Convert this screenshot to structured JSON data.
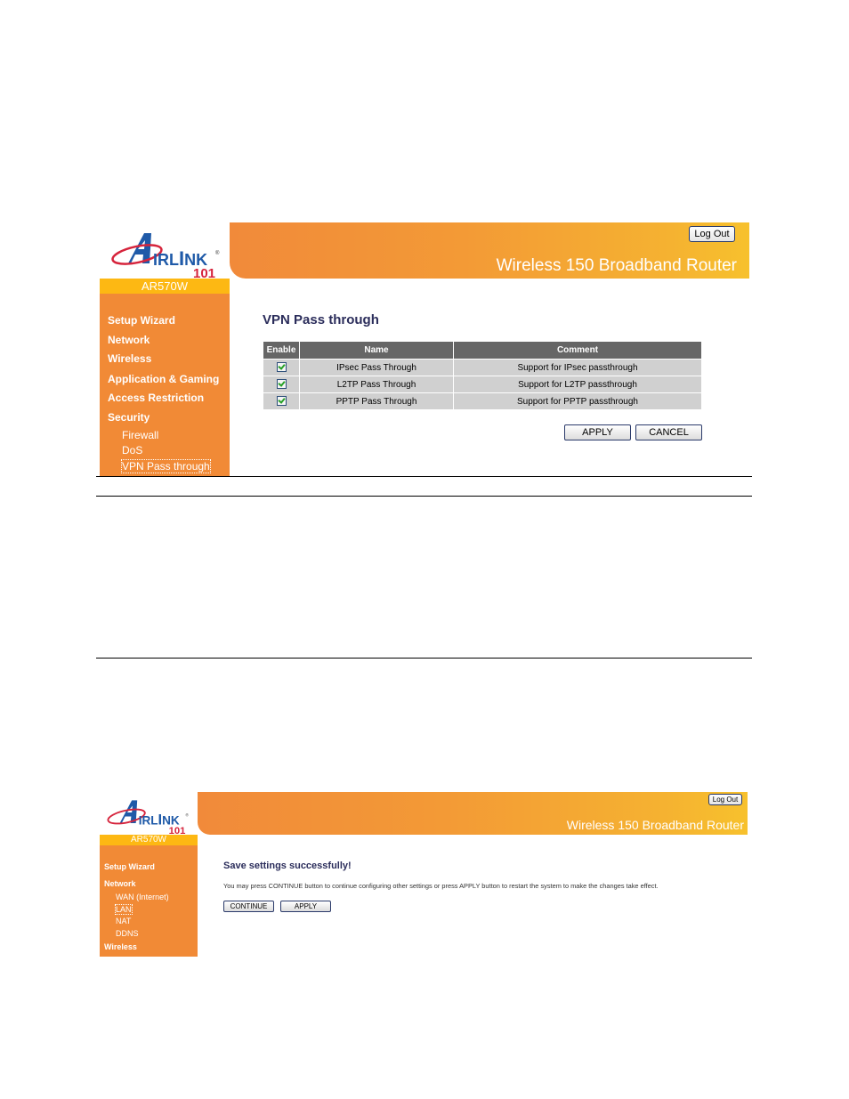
{
  "screenshot1": {
    "brand": {
      "logo_text": "AIRLINK",
      "logo_sub": "101",
      "model": "AR570W"
    },
    "header": {
      "title": "Wireless 150 Broadband Router",
      "logout_label": "Log Out"
    },
    "sidebar": {
      "items": [
        {
          "label": "Setup Wizard"
        },
        {
          "label": "Network"
        },
        {
          "label": "Wireless"
        },
        {
          "label": "Application & Gaming"
        },
        {
          "label": "Access Restriction"
        },
        {
          "label": "Security"
        }
      ],
      "subitems": [
        {
          "label": "Firewall",
          "active": false
        },
        {
          "label": "DoS",
          "active": false
        },
        {
          "label": "VPN Pass through",
          "active": true
        }
      ]
    },
    "main": {
      "title": "VPN Pass through",
      "table": {
        "headers": [
          "Enable",
          "Name",
          "Comment"
        ],
        "rows": [
          {
            "enabled": true,
            "name": "IPsec Pass Through",
            "comment": "Support for IPsec passthrough"
          },
          {
            "enabled": true,
            "name": "L2TP Pass Through",
            "comment": "Support for L2TP passthrough"
          },
          {
            "enabled": true,
            "name": "PPTP Pass Through",
            "comment": "Support for PPTP passthrough"
          }
        ]
      },
      "apply_label": "APPLY",
      "cancel_label": "CANCEL"
    }
  },
  "screenshot2": {
    "brand": {
      "logo_text": "AIRLINK",
      "logo_sub": "101",
      "model": "AR570W"
    },
    "header": {
      "title": "Wireless 150 Broadband Router",
      "logout_label": "Log Out"
    },
    "sidebar": {
      "items": [
        {
          "label": "Setup Wizard"
        },
        {
          "label": "Network"
        },
        {
          "label": "Wireless"
        }
      ],
      "subitems": [
        {
          "label": "WAN (Internet)",
          "active": false
        },
        {
          "label": "LAN",
          "active": true
        },
        {
          "label": "NAT",
          "active": false
        },
        {
          "label": "DDNS",
          "active": false
        }
      ]
    },
    "main": {
      "title": "Save settings successfully!",
      "message": "You may press CONTINUE button to continue configuring other settings or press APPLY button to restart the system to make the changes take effect.",
      "continue_label": "CONTINUE",
      "apply_label": "APPLY"
    }
  },
  "colors": {
    "sidebar": "#f18a36",
    "model_strip": "#fdb813",
    "table_header": "#666666",
    "table_row": "#d0d0d0",
    "title_text": "#2b2d5b",
    "logo_blue": "#1f5aa8",
    "logo_red": "#d6243c"
  }
}
